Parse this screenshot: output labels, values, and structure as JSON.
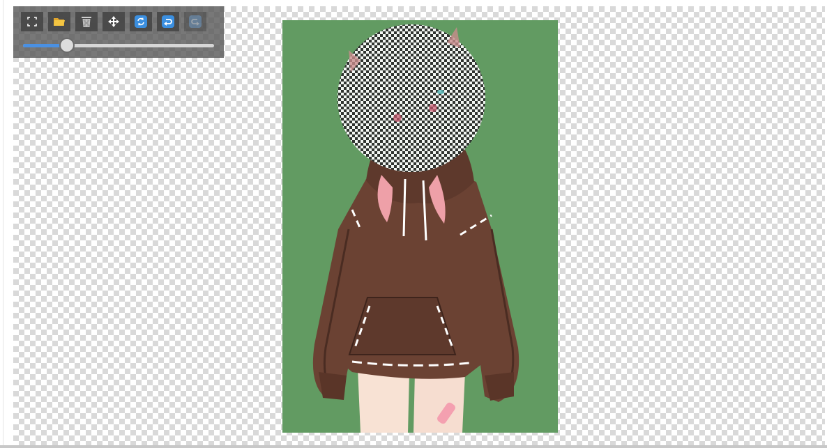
{
  "toolbar": {
    "tools": [
      {
        "name": "fullscreen",
        "icon": "fullscreen-icon",
        "enabled": true
      },
      {
        "name": "open",
        "icon": "folder-icon",
        "enabled": true
      },
      {
        "name": "clear",
        "icon": "trash-icon",
        "enabled": true
      },
      {
        "name": "move",
        "icon": "move-icon",
        "enabled": true
      },
      {
        "name": "reset",
        "icon": "refresh-icon",
        "enabled": true
      },
      {
        "name": "undo",
        "icon": "undo-icon",
        "enabled": true
      },
      {
        "name": "redo",
        "icon": "redo-icon",
        "enabled": false
      }
    ],
    "brush_size": {
      "value": 0.23
    }
  },
  "colors": {
    "toolbar_bg": "#5a5a5a",
    "accent": "#4a90e2",
    "folder": "#f4c542",
    "image_background": "#5e9a5e",
    "hoodie": "#6b4233",
    "skin": "#f8e2d4",
    "hair": "#c98c8c"
  }
}
